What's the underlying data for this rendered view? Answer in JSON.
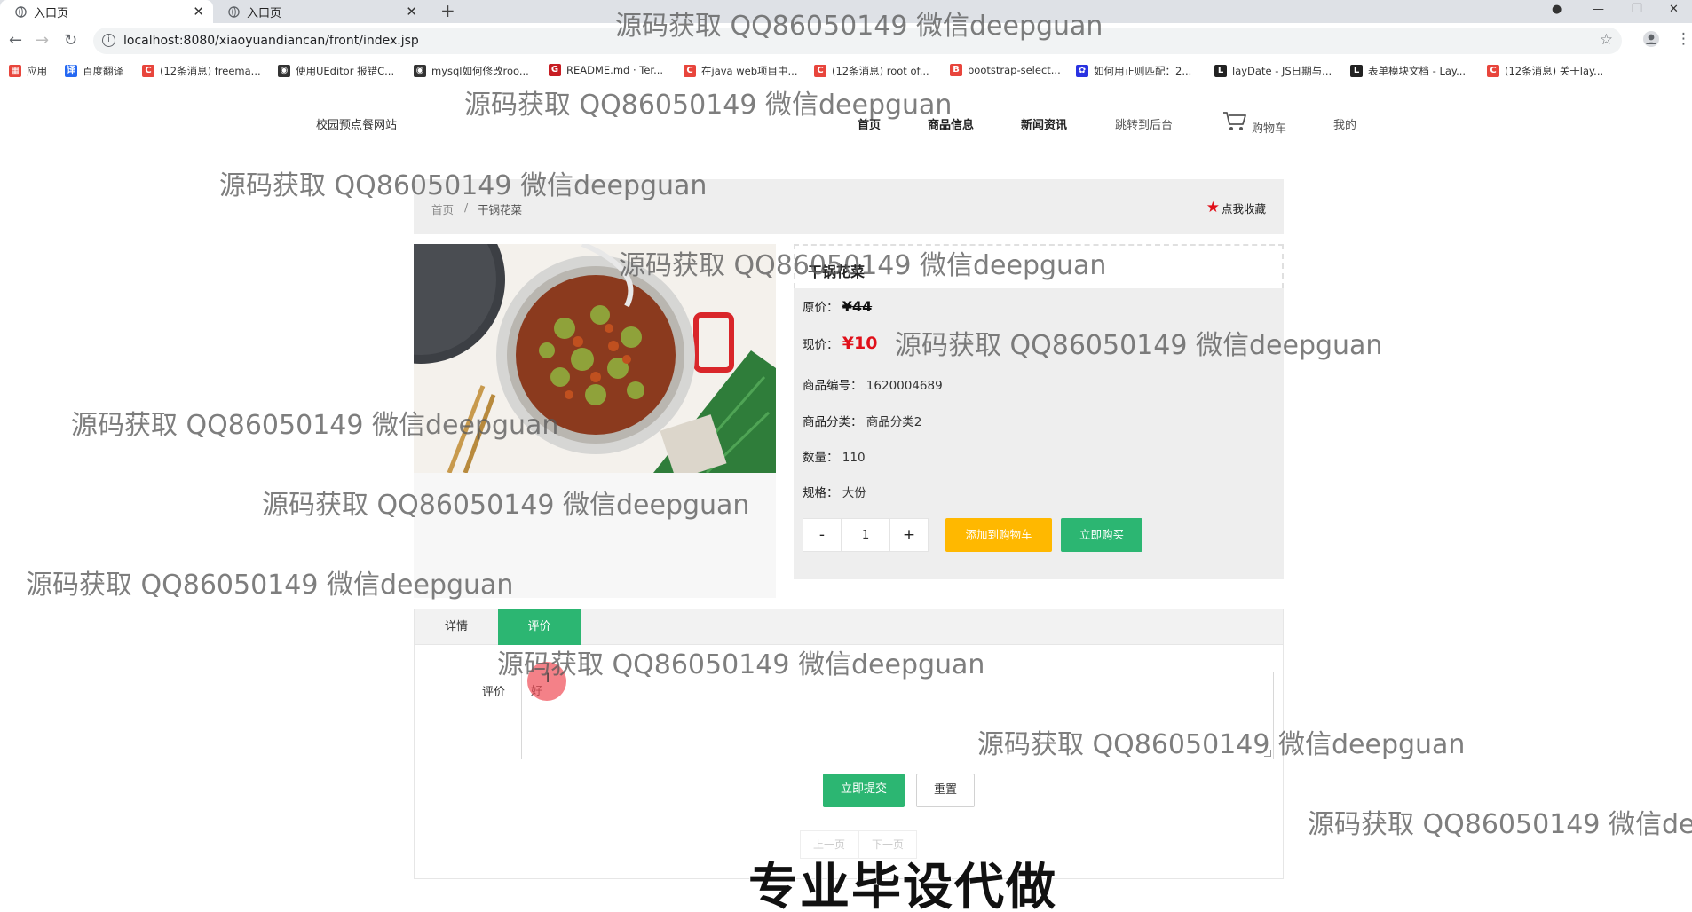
{
  "browser": {
    "tabs": [
      {
        "title": "入口页",
        "active": true
      },
      {
        "title": "入口页",
        "active": false
      }
    ],
    "url": "localhost:8080/xiaoyuandiancan/front/index.jsp",
    "bookmarks": [
      {
        "label": "应用",
        "icon": "apps-grid-icon",
        "color": "#e8453c"
      },
      {
        "label": "百度翻译",
        "icon": "baidu-translate-icon",
        "color": "#2468f2"
      },
      {
        "label": "(12条消息) freema...",
        "icon": "csdn-icon",
        "color": "#e8453c"
      },
      {
        "label": "使用UEditor 报错C...",
        "icon": "github-cat-icon",
        "color": "#333333"
      },
      {
        "label": "mysql如何修改roo...",
        "icon": "github-cat-icon",
        "color": "#333333"
      },
      {
        "label": "README.md · Ter...",
        "icon": "gitee-icon",
        "color": "#c71d23"
      },
      {
        "label": "在java web项目中...",
        "icon": "csdn-icon",
        "color": "#e8453c"
      },
      {
        "label": "(12条消息) root of...",
        "icon": "csdn-icon",
        "color": "#e8453c"
      },
      {
        "label": "bootstrap-select...",
        "icon": "bootstrap-icon",
        "color": "#e8453c"
      },
      {
        "label": "如何用正则匹配：2...",
        "icon": "baidu-paw-icon",
        "color": "#2932e1"
      },
      {
        "label": "layDate - JS日期与...",
        "icon": "layui-icon",
        "color": "#222222"
      },
      {
        "label": "表单模块文档 - Lay...",
        "icon": "layui-icon",
        "color": "#222222"
      },
      {
        "label": "(12条消息) 关于lay...",
        "icon": "csdn-icon",
        "color": "#e8453c"
      }
    ]
  },
  "site": {
    "brand": "校园预点餐网站",
    "nav": [
      {
        "label": "首页",
        "bold": true
      },
      {
        "label": "商品信息",
        "bold": true
      },
      {
        "label": "新闻资讯",
        "bold": true
      },
      {
        "label": "跳转到后台",
        "bold": false
      },
      {
        "label": "购物车",
        "bold": false,
        "icon": "cart-icon"
      },
      {
        "label": "我的",
        "bold": false
      }
    ]
  },
  "breadcrumb": {
    "home": "首页",
    "separator": "/",
    "current": "干锅花菜",
    "favorite_label": "点我收藏"
  },
  "product": {
    "name": "干锅花菜",
    "original_price_label": "原价：",
    "original_price": "¥44",
    "current_price_label": "现价：",
    "current_price": "¥10",
    "code_label": "商品编号：",
    "code": "1620004689",
    "category_label": "商品分类：",
    "category": "商品分类2",
    "quantity_label": "数量：",
    "quantity": "110",
    "spec_label": "规格：",
    "spec": "大份",
    "order_qty": "1",
    "minus": "-",
    "plus": "+",
    "add_to_cart": "添加到购物车",
    "buy_now": "立即购买"
  },
  "tabs": {
    "details": "详情",
    "review": "评价",
    "active": "review"
  },
  "review": {
    "label": "评价",
    "text": "好",
    "submit": "立即提交",
    "reset": "重置",
    "prev": "上一页",
    "next": "下一页"
  },
  "overlay": {
    "watermark": "源码获取 QQ86050149 微信deepguan",
    "watermark_cut": "源码获取 QQ86050149 微信dee",
    "promo": "专业毕设代做"
  },
  "colors": {
    "green": "#2cb672",
    "orange": "#ffb800",
    "red": "#e0101a",
    "panel": "#eeeeee"
  }
}
